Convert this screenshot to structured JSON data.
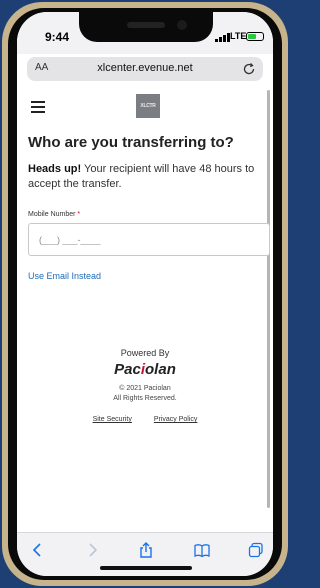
{
  "status": {
    "time": "9:44",
    "network": "LTE"
  },
  "browser": {
    "text_size_label": "AA",
    "url": "xlcenter.evenue.net"
  },
  "header": {
    "logo_text": "XLCTR"
  },
  "main": {
    "title": "Who are you transferring to?",
    "notice_bold": "Heads up!",
    "notice_text": " Your recipient will have 48 hours to accept the transfer.",
    "phone_label": "Mobile Number",
    "required_mark": "*",
    "phone_placeholder": "(___) ___-____",
    "email_link": "Use Email Instead"
  },
  "footer": {
    "powered_by": "Powered By",
    "brand_prefix": "Pac",
    "brand_mark": "i",
    "brand_suffix": "olan",
    "copyright": "© 2021 Paciolan",
    "rights": "All Rights Reserved.",
    "site_security": "Site Security",
    "privacy_policy": "Privacy Policy"
  },
  "colors": {
    "link": "#1e6bb8",
    "required": "#dd0000",
    "phone_frame": "#c7b38c",
    "background": "#1d3f73"
  },
  "icons": [
    "reload-icon",
    "hamburger-icon",
    "back-icon",
    "forward-icon",
    "share-icon",
    "bookmarks-icon",
    "tabs-icon"
  ]
}
